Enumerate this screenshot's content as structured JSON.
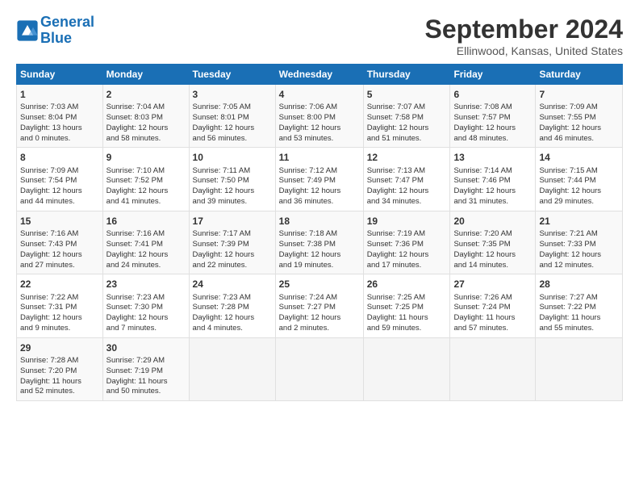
{
  "logo": {
    "text_general": "General",
    "text_blue": "Blue"
  },
  "title": "September 2024",
  "subtitle": "Ellinwood, Kansas, United States",
  "calendar": {
    "headers": [
      "Sunday",
      "Monday",
      "Tuesday",
      "Wednesday",
      "Thursday",
      "Friday",
      "Saturday"
    ],
    "rows": [
      [
        {
          "day": "1",
          "info": "Sunrise: 7:03 AM\nSunset: 8:04 PM\nDaylight: 13 hours\nand 0 minutes."
        },
        {
          "day": "2",
          "info": "Sunrise: 7:04 AM\nSunset: 8:03 PM\nDaylight: 12 hours\nand 58 minutes."
        },
        {
          "day": "3",
          "info": "Sunrise: 7:05 AM\nSunset: 8:01 PM\nDaylight: 12 hours\nand 56 minutes."
        },
        {
          "day": "4",
          "info": "Sunrise: 7:06 AM\nSunset: 8:00 PM\nDaylight: 12 hours\nand 53 minutes."
        },
        {
          "day": "5",
          "info": "Sunrise: 7:07 AM\nSunset: 7:58 PM\nDaylight: 12 hours\nand 51 minutes."
        },
        {
          "day": "6",
          "info": "Sunrise: 7:08 AM\nSunset: 7:57 PM\nDaylight: 12 hours\nand 48 minutes."
        },
        {
          "day": "7",
          "info": "Sunrise: 7:09 AM\nSunset: 7:55 PM\nDaylight: 12 hours\nand 46 minutes."
        }
      ],
      [
        {
          "day": "8",
          "info": "Sunrise: 7:09 AM\nSunset: 7:54 PM\nDaylight: 12 hours\nand 44 minutes."
        },
        {
          "day": "9",
          "info": "Sunrise: 7:10 AM\nSunset: 7:52 PM\nDaylight: 12 hours\nand 41 minutes."
        },
        {
          "day": "10",
          "info": "Sunrise: 7:11 AM\nSunset: 7:50 PM\nDaylight: 12 hours\nand 39 minutes."
        },
        {
          "day": "11",
          "info": "Sunrise: 7:12 AM\nSunset: 7:49 PM\nDaylight: 12 hours\nand 36 minutes."
        },
        {
          "day": "12",
          "info": "Sunrise: 7:13 AM\nSunset: 7:47 PM\nDaylight: 12 hours\nand 34 minutes."
        },
        {
          "day": "13",
          "info": "Sunrise: 7:14 AM\nSunset: 7:46 PM\nDaylight: 12 hours\nand 31 minutes."
        },
        {
          "day": "14",
          "info": "Sunrise: 7:15 AM\nSunset: 7:44 PM\nDaylight: 12 hours\nand 29 minutes."
        }
      ],
      [
        {
          "day": "15",
          "info": "Sunrise: 7:16 AM\nSunset: 7:43 PM\nDaylight: 12 hours\nand 27 minutes."
        },
        {
          "day": "16",
          "info": "Sunrise: 7:16 AM\nSunset: 7:41 PM\nDaylight: 12 hours\nand 24 minutes."
        },
        {
          "day": "17",
          "info": "Sunrise: 7:17 AM\nSunset: 7:39 PM\nDaylight: 12 hours\nand 22 minutes."
        },
        {
          "day": "18",
          "info": "Sunrise: 7:18 AM\nSunset: 7:38 PM\nDaylight: 12 hours\nand 19 minutes."
        },
        {
          "day": "19",
          "info": "Sunrise: 7:19 AM\nSunset: 7:36 PM\nDaylight: 12 hours\nand 17 minutes."
        },
        {
          "day": "20",
          "info": "Sunrise: 7:20 AM\nSunset: 7:35 PM\nDaylight: 12 hours\nand 14 minutes."
        },
        {
          "day": "21",
          "info": "Sunrise: 7:21 AM\nSunset: 7:33 PM\nDaylight: 12 hours\nand 12 minutes."
        }
      ],
      [
        {
          "day": "22",
          "info": "Sunrise: 7:22 AM\nSunset: 7:31 PM\nDaylight: 12 hours\nand 9 minutes."
        },
        {
          "day": "23",
          "info": "Sunrise: 7:23 AM\nSunset: 7:30 PM\nDaylight: 12 hours\nand 7 minutes."
        },
        {
          "day": "24",
          "info": "Sunrise: 7:23 AM\nSunset: 7:28 PM\nDaylight: 12 hours\nand 4 minutes."
        },
        {
          "day": "25",
          "info": "Sunrise: 7:24 AM\nSunset: 7:27 PM\nDaylight: 12 hours\nand 2 minutes."
        },
        {
          "day": "26",
          "info": "Sunrise: 7:25 AM\nSunset: 7:25 PM\nDaylight: 11 hours\nand 59 minutes."
        },
        {
          "day": "27",
          "info": "Sunrise: 7:26 AM\nSunset: 7:24 PM\nDaylight: 11 hours\nand 57 minutes."
        },
        {
          "day": "28",
          "info": "Sunrise: 7:27 AM\nSunset: 7:22 PM\nDaylight: 11 hours\nand 55 minutes."
        }
      ],
      [
        {
          "day": "29",
          "info": "Sunrise: 7:28 AM\nSunset: 7:20 PM\nDaylight: 11 hours\nand 52 minutes."
        },
        {
          "day": "30",
          "info": "Sunrise: 7:29 AM\nSunset: 7:19 PM\nDaylight: 11 hours\nand 50 minutes."
        },
        {
          "day": "",
          "info": ""
        },
        {
          "day": "",
          "info": ""
        },
        {
          "day": "",
          "info": ""
        },
        {
          "day": "",
          "info": ""
        },
        {
          "day": "",
          "info": ""
        }
      ]
    ]
  }
}
